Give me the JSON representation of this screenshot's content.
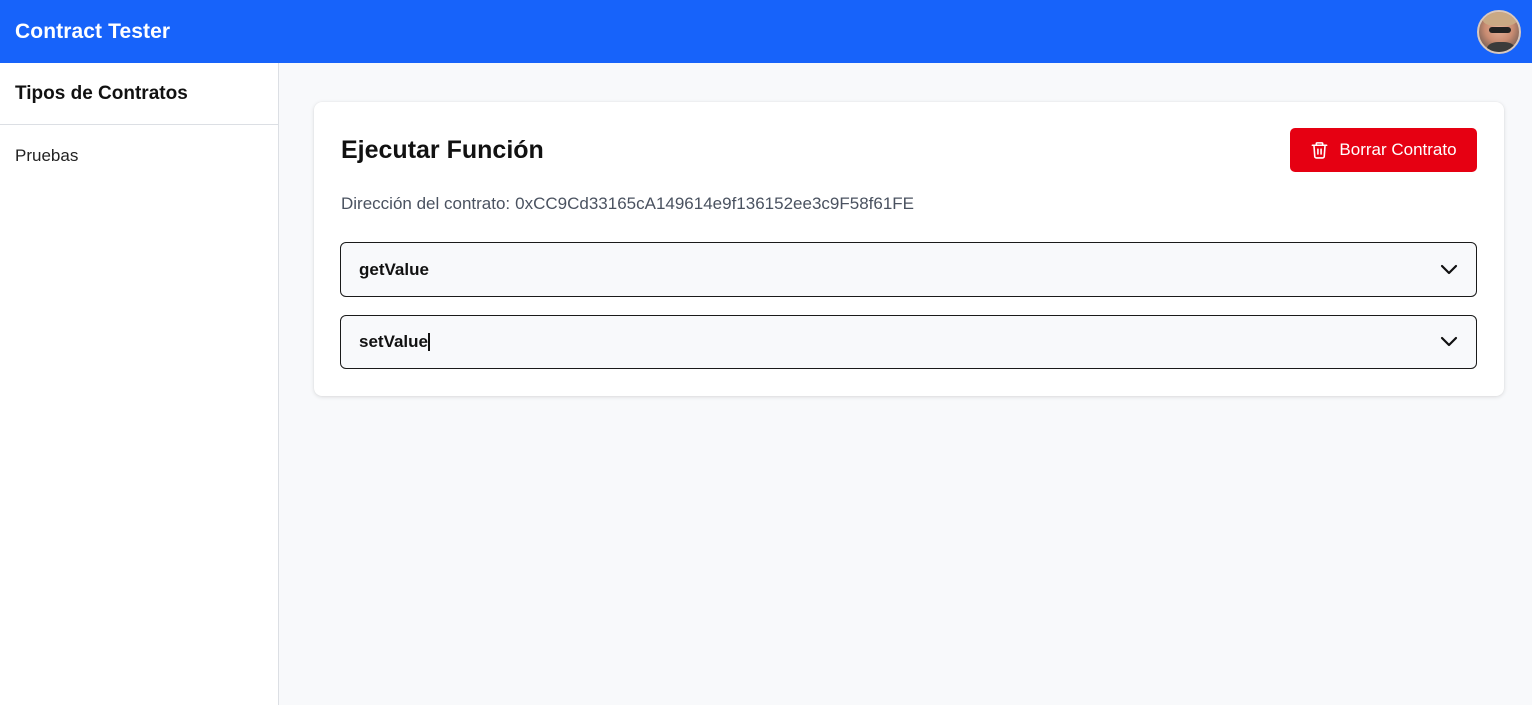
{
  "header": {
    "title": "Contract Tester",
    "avatar_icon": "user-avatar"
  },
  "sidebar": {
    "title": "Tipos de Contratos",
    "items": [
      {
        "label": "Pruebas"
      }
    ]
  },
  "main": {
    "card_title": "Ejecutar Función",
    "delete_button_label": "Borrar Contrato",
    "delete_button_icon": "trash-icon",
    "address_label": "Dirección del contrato:",
    "address_value": "0xCC9Cd33165cA149614e9f136152ee3c9F58f61FE",
    "functions": [
      {
        "name": "getValue",
        "expanded": false
      },
      {
        "name": "setValue",
        "expanded": false
      }
    ]
  },
  "colors": {
    "header_bg": "#1763fa",
    "delete_button_bg": "#e60012",
    "page_bg": "#f8f9fb"
  }
}
